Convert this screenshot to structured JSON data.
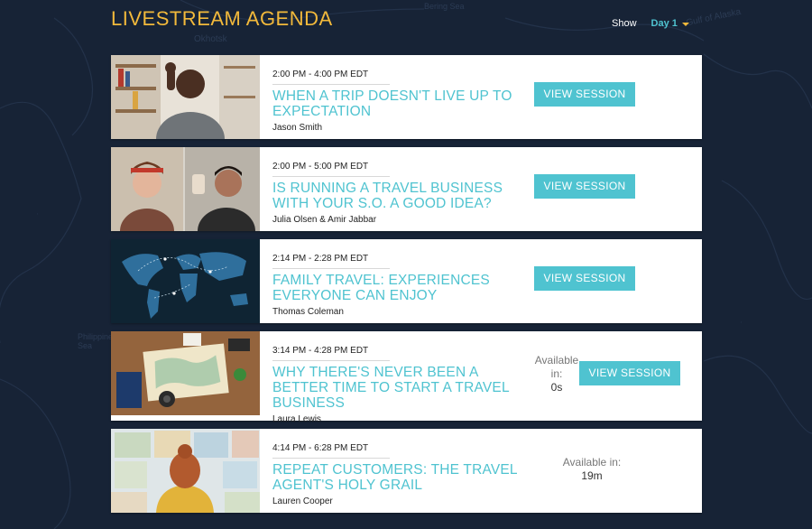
{
  "header": {
    "title": "LIVESTREAM AGENDA",
    "show_label": "Show",
    "day_value": "Day 1"
  },
  "map_labels": [
    "Okhotsk",
    "Gulf of Alaska",
    "Bering Sea",
    "Philippine Sea"
  ],
  "sessions": [
    {
      "time": "2:00 PM - 4:00 PM EDT",
      "title": "WHEN A TRIP DOESN'T LIVE UP TO EXPECTATION",
      "speaker": "Jason Smith",
      "button": "VIEW SESSION"
    },
    {
      "time": "2:00 PM - 5:00 PM EDT",
      "title": "IS RUNNING A TRAVEL BUSINESS WITH YOUR S.O. A GOOD IDEA?",
      "speaker": "Julia Olsen & Amir Jabbar",
      "button": "VIEW SESSION"
    },
    {
      "time": "2:14 PM - 2:28 PM EDT",
      "title": "FAMILY TRAVEL: EXPERIENCES EVERYONE CAN ENJOY",
      "speaker": "Thomas Coleman",
      "button": "VIEW SESSION"
    },
    {
      "time": "3:14 PM - 4:28 PM EDT",
      "title": "WHY THERE'S NEVER BEEN A BETTER TIME TO START A TRAVEL BUSINESS",
      "speaker": "Laura Lewis",
      "available_label": "Available in:",
      "available_value": "0s",
      "button": "VIEW SESSION"
    },
    {
      "time": "4:14 PM - 6:28 PM EDT",
      "title": "REPEAT CUSTOMERS: THE TRAVEL AGENT'S HOLY GRAIL",
      "speaker": "Lauren Cooper",
      "available_label": "Available in:",
      "available_value": "19m"
    }
  ],
  "colors": {
    "background": "#172336",
    "title_accent": "#f2b93b",
    "teal": "#4fc3d0"
  }
}
